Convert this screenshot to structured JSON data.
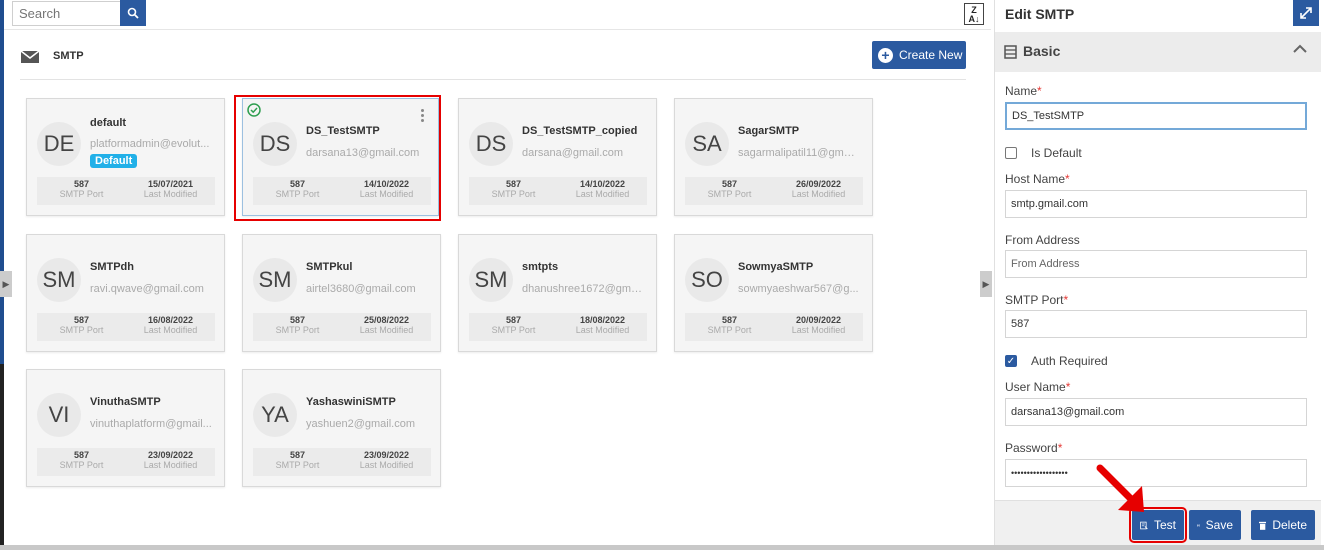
{
  "search": {
    "placeholder": "Search"
  },
  "header": {
    "title": "SMTP",
    "create_label": "Create New"
  },
  "cards": [
    {
      "initials": "DE",
      "name": "default",
      "email": "platformadmin@evolut...",
      "badge": "Default",
      "port": "587",
      "port_label": "SMTP Port",
      "date": "15/07/2021",
      "date_label": "Last Modified"
    },
    {
      "initials": "DS",
      "name": "DS_TestSMTP",
      "email": "darsana13@gmail.com",
      "port": "587",
      "port_label": "SMTP Port",
      "date": "14/10/2022",
      "date_label": "Last Modified"
    },
    {
      "initials": "DS",
      "name": "DS_TestSMTP_copied",
      "email": "darsana@gmail.com",
      "port": "587",
      "port_label": "SMTP Port",
      "date": "14/10/2022",
      "date_label": "Last Modified"
    },
    {
      "initials": "SA",
      "name": "SagarSMTP",
      "email": "sagarmalipatil11@gmai...",
      "port": "587",
      "port_label": "SMTP Port",
      "date": "26/09/2022",
      "date_label": "Last Modified"
    },
    {
      "initials": "SM",
      "name": "SMTPdh",
      "email": "ravi.qwave@gmail.com",
      "port": "587",
      "port_label": "SMTP Port",
      "date": "16/08/2022",
      "date_label": "Last Modified"
    },
    {
      "initials": "SM",
      "name": "SMTPkul",
      "email": "airtel3680@gmail.com",
      "port": "587",
      "port_label": "SMTP Port",
      "date": "25/08/2022",
      "date_label": "Last Modified"
    },
    {
      "initials": "SM",
      "name": "smtpts",
      "email": "dhanushree1672@gma...",
      "port": "587",
      "port_label": "SMTP Port",
      "date": "18/08/2022",
      "date_label": "Last Modified"
    },
    {
      "initials": "SO",
      "name": "SowmyaSMTP",
      "email": "sowmyaeshwar567@g...",
      "port": "587",
      "port_label": "SMTP Port",
      "date": "20/09/2022",
      "date_label": "Last Modified"
    },
    {
      "initials": "VI",
      "name": "VinuthaSMTP",
      "email": "vinuthaplatform@gmail...",
      "port": "587",
      "port_label": "SMTP Port",
      "date": "23/09/2022",
      "date_label": "Last Modified"
    },
    {
      "initials": "YA",
      "name": "YashaswiniSMTP",
      "email": "yashuen2@gmail.com",
      "port": "587",
      "port_label": "SMTP Port",
      "date": "23/09/2022",
      "date_label": "Last Modified"
    }
  ],
  "panel": {
    "title": "Edit SMTP",
    "section": "Basic",
    "name_label": "Name",
    "name_value": "DS_TestSMTP",
    "is_default_label": "Is Default",
    "host_label": "Host Name",
    "host_value": "smtp.gmail.com",
    "from_label": "From Address",
    "from_placeholder": "From Address",
    "port_label": "SMTP Port",
    "port_value": "587",
    "auth_label": "Auth Required",
    "user_label": "User Name",
    "user_value": "darsana13@gmail.com",
    "password_label": "Password",
    "password_value": "••••••••••••••••••",
    "required_mark": "*"
  },
  "footer": {
    "test_label": "Test",
    "save_label": "Save",
    "delete_label": "Delete"
  },
  "colors": {
    "accent": "#2b5aa0",
    "badge": "#21b0e8",
    "highlight": "#e60000",
    "success": "#2e9e4f"
  }
}
